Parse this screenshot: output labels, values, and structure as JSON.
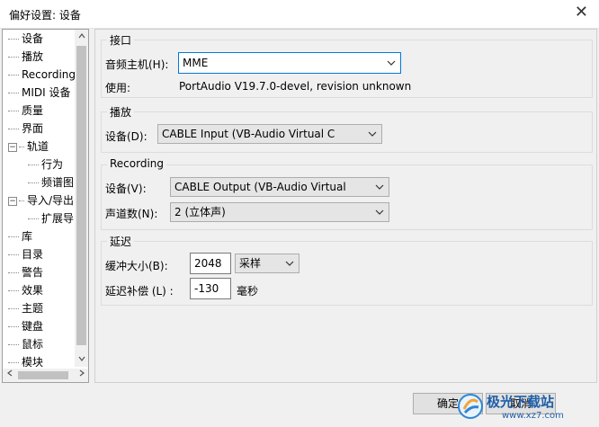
{
  "window": {
    "title": "偏好设置:  设备",
    "close_label": "✕"
  },
  "tree": {
    "items": [
      {
        "label": "设备"
      },
      {
        "label": "播放"
      },
      {
        "label": "Recording"
      },
      {
        "label": "MIDI 设备"
      },
      {
        "label": "质量"
      },
      {
        "label": "界面"
      },
      {
        "label": "轨道"
      },
      {
        "label": "行为"
      },
      {
        "label": "频谱图"
      },
      {
        "label": "导入/导出"
      },
      {
        "label": "扩展导"
      },
      {
        "label": "库"
      },
      {
        "label": "目录"
      },
      {
        "label": "警告"
      },
      {
        "label": "效果"
      },
      {
        "label": "主题"
      },
      {
        "label": "键盘"
      },
      {
        "label": "鼠标"
      },
      {
        "label": "模块"
      }
    ],
    "collapse_glyph": "−"
  },
  "interface": {
    "title": "接口",
    "host_label": "音频主机(H):",
    "host_value": "MME",
    "using_label": "使用:",
    "using_value": "PortAudio V19.7.0-devel, revision unknown"
  },
  "playback": {
    "title": "播放",
    "device_label": "设备(D):",
    "device_value": "CABLE Input (VB-Audio Virtual C"
  },
  "recording": {
    "title": "Recording",
    "device_label": "设备(V):",
    "device_value": "CABLE Output (VB-Audio Virtual",
    "channels_label": "声道数(N):",
    "channels_value": "2 (立体声)"
  },
  "latency": {
    "title": "延迟",
    "buffer_label": "缓冲大小(B):",
    "buffer_value": "2048",
    "buffer_unit": "采样",
    "comp_label": "延迟补偿 (L) :",
    "comp_value": "-130",
    "comp_unit": "毫秒"
  },
  "buttons": {
    "ok": "确定",
    "cancel": "取消"
  },
  "watermark": {
    "text": "极光下载站",
    "url": "www.xz7.com"
  }
}
